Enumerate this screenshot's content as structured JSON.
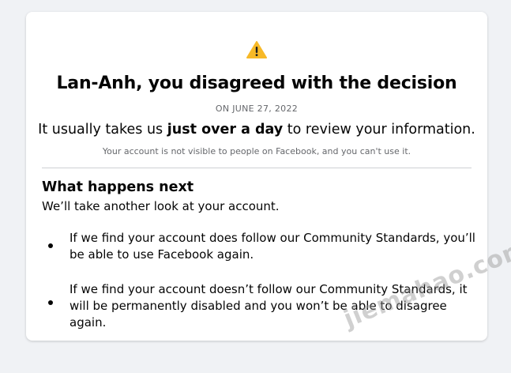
{
  "header": {
    "icon": "warning-icon",
    "title": "Lan-Anh, you disagreed with the decision",
    "date": "ON JUNE 27, 2022"
  },
  "review": {
    "prefix": "It usually takes us ",
    "emphasis": "just over a day",
    "suffix": " to review your information."
  },
  "visibility_note": "Your account is not visible to people on Facebook, and you can't use it.",
  "next": {
    "heading": "What happens next",
    "intro": "We’ll take another look at your account.",
    "items": [
      "If we find your account does follow our Community Standards, you’ll be able to use Facebook again.",
      "If we find your account doesn’t follow our Community Standards, it will be permanently disabled and you won’t be able to disagree again."
    ]
  },
  "watermark": "jiemahao.com",
  "colors": {
    "background": "#f0f2f5",
    "card": "#ffffff",
    "warning": "#f7b928",
    "secondary_text": "#65676b"
  }
}
